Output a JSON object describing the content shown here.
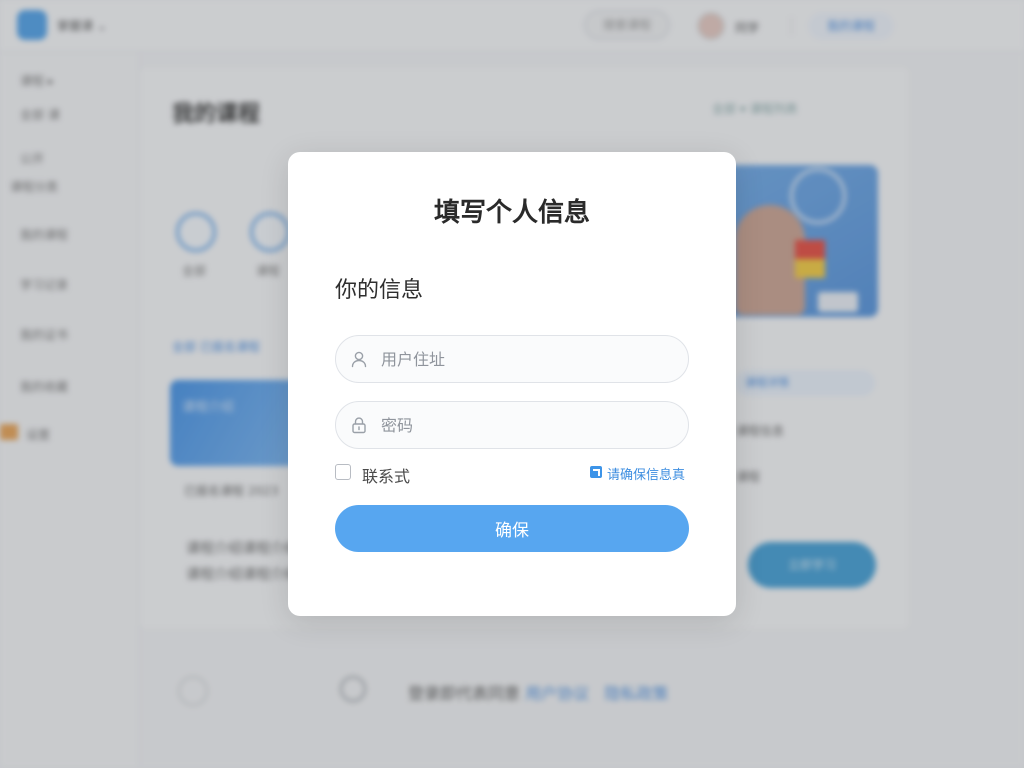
{
  "background": {
    "topbar": {
      "app_name": "掌握课 ⌄",
      "search_label": "搜索课程",
      "user_name": "同学",
      "login_link": "我的课程"
    },
    "sidebar": {
      "items": [
        "课程 ▸",
        "全部 课",
        "公开",
        "课程分类",
        "我的课程",
        "学习记录",
        "我的证书",
        "我的收藏",
        "设置"
      ]
    },
    "main": {
      "title": "我的课程",
      "right_link": "全部 ▾ 课程列表",
      "circles": [
        {
          "label": "全部"
        },
        {
          "label": "课程"
        }
      ],
      "filter_text": "全部 已报名课程",
      "banner_text": "课程介绍",
      "card_caption": "已报名课程 2023",
      "desc_line_1": "课程介绍课程介绍课程",
      "desc_line_2": "课程介绍课程介绍",
      "right_chip": "课程详情",
      "right_line_1": "课程信息",
      "right_line_2": "课程",
      "right_button": "立即学习"
    },
    "footer": {
      "text_prefix": "登录即代表同意",
      "link_1": "用户协议",
      "link_2": "隐私政策"
    }
  },
  "modal": {
    "title": "填写个人信息",
    "section_label": "你的信息",
    "username_placeholder": "用户住址",
    "password_placeholder": "密码",
    "contact_label": "联系式",
    "contact_checked": false,
    "notice_text": "请确保信息真",
    "confirm_label": "确保"
  },
  "colors": {
    "accent": "#57a6f0",
    "link": "#3d8ee0",
    "overlay": "rgba(90,92,98,0.28)"
  },
  "icons": {
    "username": "user-icon",
    "password": "lock-icon",
    "notice": "info-icon"
  }
}
